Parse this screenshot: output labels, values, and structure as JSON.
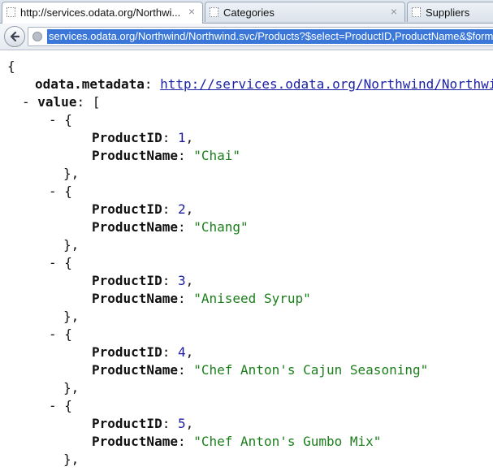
{
  "browser": {
    "tabs": [
      {
        "title": "http://services.odata.org/Northwi..."
      },
      {
        "title": "Categories"
      },
      {
        "title": "Suppliers"
      }
    ],
    "close_glyph": "×",
    "url": "services.odata.org/Northwind/Northwind.svc/Products?$select=ProductID,ProductName&$forma"
  },
  "json_view": {
    "open_brace": "{",
    "metadata_key": "odata.metadata",
    "colon": ":",
    "metadata_url": "http://services.odata.org/Northwind/Northwind.svc/$metadata#Products&$select=ProductID,ProductName",
    "collapse_symbol": "-",
    "value_key": "value",
    "open_bracket": "[",
    "open_obj": "{",
    "close_obj": "},",
    "id_key": "ProductID",
    "name_key": "ProductName",
    "items": [
      {
        "id": "1",
        "name": "\"Chai\""
      },
      {
        "id": "2",
        "name": "\"Chang\""
      },
      {
        "id": "3",
        "name": "\"Aniseed Syrup\""
      },
      {
        "id": "4",
        "name": "\"Chef Anton's Cajun Seasoning\""
      },
      {
        "id": "5",
        "name": "\"Chef Anton's Gumbo Mix\""
      }
    ]
  }
}
